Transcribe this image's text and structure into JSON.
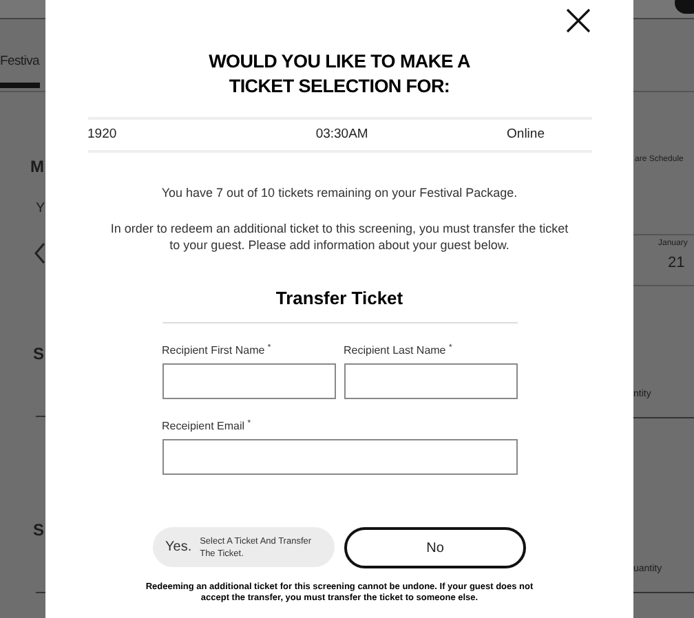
{
  "background": {
    "tab": "Festiva",
    "heading": "M",
    "subtext": "Y",
    "section_1": "S",
    "section_2": "S",
    "share_link": "are Schedule",
    "date_month": "January",
    "date_day": "21",
    "column_1": "ntity",
    "column_2": "uantity"
  },
  "modal": {
    "title": "WOULD YOU LIKE TO MAKE A TICKET SELECTION FOR:",
    "selection": {
      "film": "1920",
      "time": "03:30AM",
      "venue": "Online"
    },
    "remaining_message": "You have 7 out of 10 tickets remaining on your Festival Package.",
    "transfer_message": "In order to redeem an additional ticket to this screening, you must transfer the ticket to your guest. Please add information about your guest below.",
    "form_title": "Transfer Ticket",
    "fields": [
      {
        "label": "Recipient First Name $^{*}$"
      },
      {
        "label": "Recipient Last Name $^{*}$"
      },
      {
        "label": "Receipient Email $^{*}$"
      }
    ],
    "yes_button": {
      "label": "Yes.",
      "detail": "Select A Ticket And Transfer The Ticket."
    },
    "no_button": {
      "label": "No"
    },
    "disclaimer": "Redeeming an additional ticket for this screening cannot be undone. If your guest does not accept the transfer, you must transfer the ticket to someone else."
  }
}
